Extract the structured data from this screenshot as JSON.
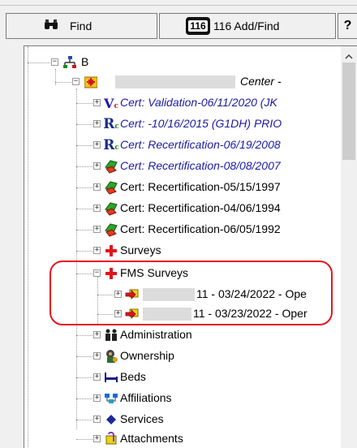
{
  "toolbar": {
    "find_label": "Find",
    "addfind_label": "116 Add/Find",
    "addfind_badge": "116",
    "help_glyph": "?"
  },
  "tree": {
    "root_label": "B",
    "facility_label": "Center -",
    "certs": [
      {
        "label": "Cert: Validation-06/11/2020 (JK",
        "style": "blue",
        "icon": "v-icon"
      },
      {
        "label": "Cert: -10/16/2015 (G1DH) PRIO",
        "style": "blue",
        "icon": "r-icon"
      },
      {
        "label": "Cert: Recertification-06/19/2008",
        "style": "blue",
        "icon": "r-icon"
      },
      {
        "label": "Cert: Recertification-08/08/2007",
        "style": "blue",
        "icon": "survey-icon"
      },
      {
        "label": "Cert: Recertification-05/15/1997",
        "style": "black",
        "icon": "survey-icon"
      },
      {
        "label": "Cert: Recertification-04/06/1994",
        "style": "black",
        "icon": "survey-icon"
      },
      {
        "label": "Cert: Recertification-06/05/1992",
        "style": "black",
        "icon": "survey-icon"
      }
    ],
    "surveys_label": "Surveys",
    "fms_label": "FMS Surveys",
    "fms_items": [
      {
        "label": "11 - 03/24/2022 - Ope"
      },
      {
        "label": "11 - 03/23/2022 - Oper"
      }
    ],
    "bottom_items": [
      {
        "label": "Administration",
        "icon": "people-icon"
      },
      {
        "label": "Ownership",
        "icon": "ownership-icon"
      },
      {
        "label": "Beds",
        "icon": "bed-icon"
      },
      {
        "label": "Affiliations",
        "icon": "affiliations-icon"
      },
      {
        "label": "Services",
        "icon": "diamond-icon"
      },
      {
        "label": "Attachments",
        "icon": "attachments-icon"
      }
    ]
  },
  "colors": {
    "annotation": "#e8141e",
    "blue_text": "#1a1aa6"
  }
}
